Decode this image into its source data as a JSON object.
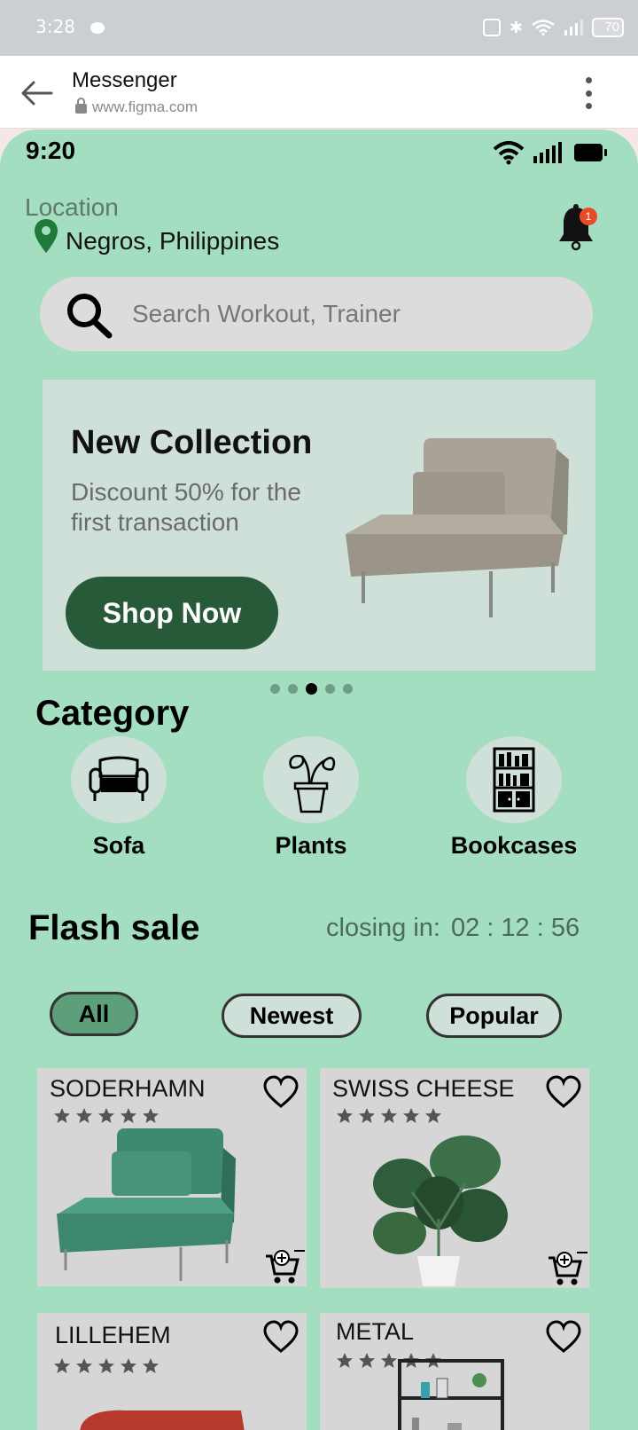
{
  "system_bar": {
    "time": "3:28",
    "battery": "70"
  },
  "browser": {
    "title": "Messenger",
    "url": "www.figma.com"
  },
  "app": {
    "time": "9:20",
    "location": {
      "label": "Location",
      "value": "Negros, Philippines"
    },
    "notifications": {
      "count": "1"
    },
    "search": {
      "placeholder": "Search Workout, Trainer"
    },
    "banner": {
      "title": "New Collection",
      "subtitle": "Discount 50% for the first transaction",
      "button": "Shop Now",
      "dots_total": 5,
      "active_dot": 3
    },
    "category": {
      "heading": "Category",
      "items": [
        {
          "label": "Sofa",
          "icon": "sofa-icon"
        },
        {
          "label": "Plants",
          "icon": "plant-icon"
        },
        {
          "label": "Bookcases",
          "icon": "bookcase-icon"
        }
      ]
    },
    "flash_sale": {
      "heading": "Flash sale",
      "closing_label": "closing in:",
      "closing_time": "02 : 12 : 56",
      "filters": [
        {
          "label": "All",
          "active": true
        },
        {
          "label": "Newest",
          "active": false
        },
        {
          "label": "Popular",
          "active": false
        }
      ],
      "products": [
        {
          "name": "SODERHAMN",
          "rating": 5
        },
        {
          "name": "SWISS CHEESE",
          "rating": 5
        },
        {
          "name": "LILLEHEM",
          "rating": 5
        },
        {
          "name": "METAL",
          "rating": 5
        }
      ]
    }
  },
  "colors": {
    "app_background": "#a3dec1",
    "accent_dark_green": "#275a38",
    "chip_active": "#5d9e7b",
    "badge": "#e84b27"
  }
}
